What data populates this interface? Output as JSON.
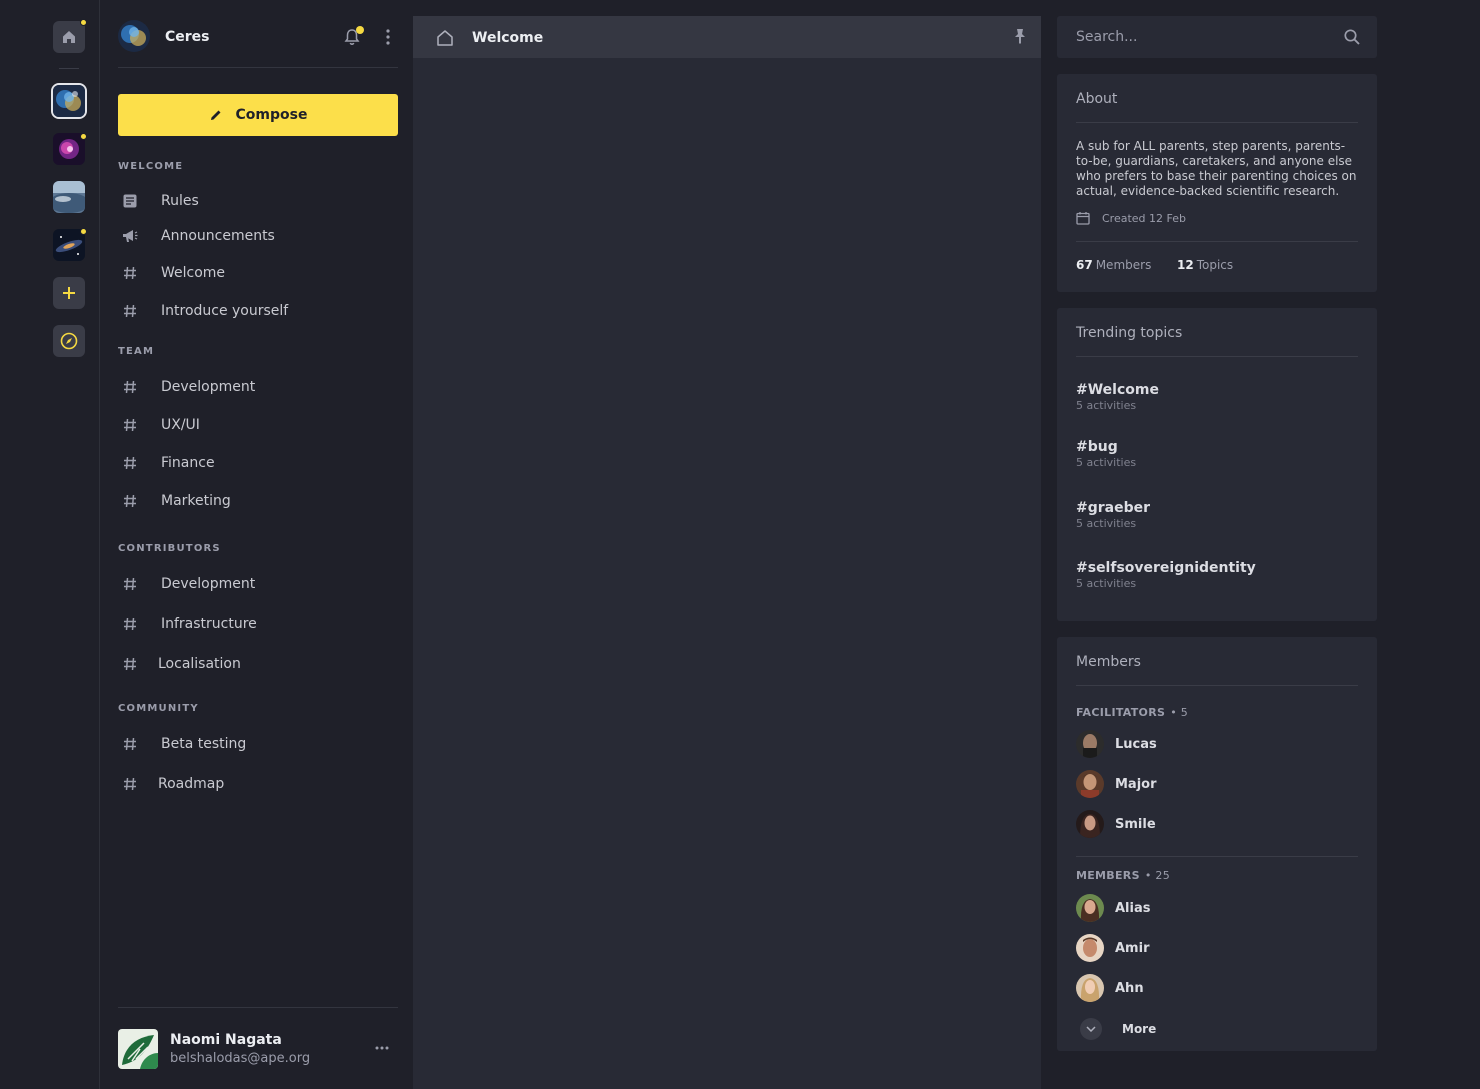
{
  "server": {
    "name": "Ceres"
  },
  "compose_label": "Compose",
  "sections": [
    {
      "label": "WELCOME",
      "channels": [
        {
          "label": "Rules",
          "icon": "rules-icon"
        },
        {
          "label": "Announcements",
          "icon": "megaphone-icon"
        },
        {
          "label": "Welcome",
          "icon": "hash-icon"
        },
        {
          "label": "Introduce yourself",
          "icon": "hash-icon"
        }
      ]
    },
    {
      "label": "TEAM",
      "channels": [
        {
          "label": "Development",
          "icon": "hash-icon"
        },
        {
          "label": "UX/UI",
          "icon": "hash-icon"
        },
        {
          "label": "Finance",
          "icon": "hash-icon"
        },
        {
          "label": "Marketing",
          "icon": "hash-icon"
        }
      ]
    },
    {
      "label": "CONTRIBUTORS",
      "channels": [
        {
          "label": "Development",
          "icon": "hash-icon"
        },
        {
          "label": "Infrastructure",
          "icon": "hash-icon"
        },
        {
          "label": "Localisation",
          "icon": "hash-icon"
        }
      ]
    },
    {
      "label": "COMMUNITY",
      "channels": [
        {
          "label": "Beta testing",
          "icon": "hash-icon"
        },
        {
          "label": "Roadmap",
          "icon": "hash-icon"
        }
      ]
    }
  ],
  "user": {
    "name": "Naomi Nagata",
    "email": "belshalodas@ape.org"
  },
  "main": {
    "title": "Welcome"
  },
  "search": {
    "placeholder": "Search..."
  },
  "about": {
    "title": "About",
    "description": "A sub for ALL parents, step parents, parents-to-be, guardians, caretakers, and anyone else who prefers to base their parenting choices on actual, evidence-backed scientific research.",
    "created": "Created 12 Feb",
    "members_count": "67",
    "members_label": "Members",
    "topics_count": "12",
    "topics_label": "Topics"
  },
  "trending": {
    "title": "Trending topics",
    "topics": [
      {
        "tag": "#Welcome",
        "count": "5 activities"
      },
      {
        "tag": "#bug",
        "count": "5 activities"
      },
      {
        "tag": "#graeber",
        "count": "5 activities"
      },
      {
        "tag": "#selfsovereignidentity",
        "count": "5 activities"
      }
    ]
  },
  "members": {
    "title": "Members",
    "facilitators_label": "FACILITATORS",
    "facilitators_count": "• 5",
    "facilitators": [
      {
        "name": "Lucas"
      },
      {
        "name": "Major"
      },
      {
        "name": "Smile"
      }
    ],
    "members_label": "MEMBERS",
    "members_count": "• 25",
    "members": [
      {
        "name": "Alias"
      },
      {
        "name": "Amir"
      },
      {
        "name": "Ahn"
      }
    ],
    "more_label": "More"
  },
  "colors": {
    "accent": "#fcdf4a",
    "notification": "#f5d942",
    "background": "#1f2029",
    "panel": "#282a35"
  }
}
